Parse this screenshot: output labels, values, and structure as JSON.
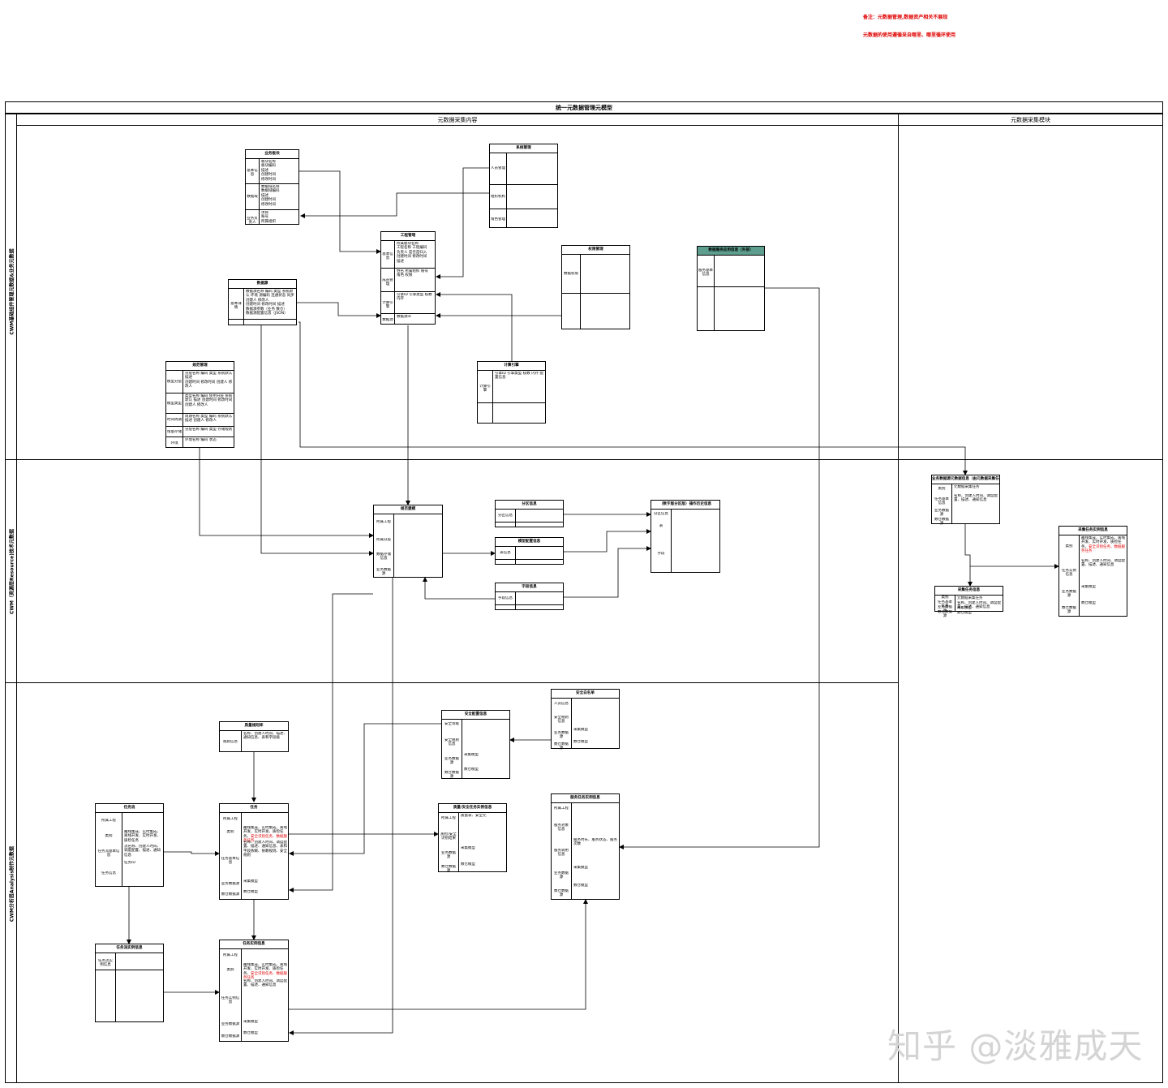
{
  "notes": [
    "备注：元数据管理,数据资产相关不展现",
    "元数据的使用遵循采自哪里、哪里循环使用"
  ],
  "main_title": "统一元数据管理元模型",
  "column_titles": {
    "content": "元数据采集内容",
    "module": "元数据采集模块"
  },
  "lanes": [
    "CWM基础组件管理元数据&业务元数据",
    "CWM（资源层Resource)技术元数据",
    "CWM分析层Analysis制作元数据"
  ],
  "watermark": "知乎 @淡雅成天",
  "entities": {
    "business_module": {
      "title": "业务板块",
      "rows": [
        {
          "k": "基本信息",
          "v": "板块名称\n板块编码\n描述\n创建时间\n修改时间"
        },
        {
          "k": "数据域",
          "v": "数据域名称\n数据域编码\n描述\n创建时间\n修改时间"
        },
        {
          "k": "业务负责人",
          "v": "项目\n账号\n所属组织"
        }
      ]
    },
    "system_mgmt": {
      "title": "系统管理",
      "rows": [
        {
          "k": "人员管理",
          "v": ""
        },
        {
          "k": "组织机构",
          "v": ""
        },
        {
          "k": "角色管理",
          "v": ""
        }
      ]
    },
    "project_mgmt": {
      "title": "工程管理",
      "rows": [
        {
          "k": "基本信息",
          "v": "所属板块名称\n工程名称 工程编码\n负责人 是否是归入\n创建时间 修改时间\n描述"
        },
        {
          "k": "成员管理",
          "v": "姓名 所属组织 账号\n角色 权限"
        },
        {
          "k": "计算引擎",
          "v": "引擎ID 引擎类型 核数\n内存"
        },
        {
          "k": "数据源",
          "v": "数据源id"
        }
      ]
    },
    "permission_mgmt": {
      "title": "权限管理",
      "rows": [
        {
          "k": "数据权限",
          "v": ""
        },
        {
          "k": "",
          "v": ""
        }
      ]
    },
    "data_service_ext": {
      "title": "数据服务应用信息（外部）",
      "rows": [
        {
          "k": "服务基本信息",
          "v": ""
        },
        {
          "k": "",
          "v": ""
        }
      ]
    },
    "data_source": {
      "title": "数据源",
      "rows": [
        {
          "k": "基本详情",
          "v": "数据源名称 编码 类型 系统默认 环境 源编码 连通状态 同步 创建人 修改人\n创建时间 修改时间 描述\n数据源参数（业务 数仓）\n数据源配置信息（JSON）"
        },
        {
          "k": "",
          "v": ""
        }
      ]
    },
    "compute_engine": {
      "title": "计算引擎",
      "rows": [
        {
          "k": "计算引擎",
          "v": "引擎ID 引擎类型 核数 内存 配置信息"
        },
        {
          "k": "",
          "v": ""
        }
      ]
    },
    "spec_mgmt": {
      "title": "规范管理",
      "rows": [
        {
          "k": "模型分层",
          "v": "分层名称 编码 类型 系统默认 描述\n创建时间 修改时间 创建人 修改人"
        },
        {
          "k": "模型类型",
          "v": "类型名称 编码 使用分层 系统默认 描述 创建时间 修改时间\n创建人 修改人"
        },
        {
          "k": "时间周期",
          "v": "周期名称 类型 编码 系统默认 描述 创建人 修改人"
        },
        {
          "k": "增量存储",
          "v": "分层名称 编码 类型 存储规则"
        },
        {
          "k": "环境",
          "v": "环境名称 编码 状态"
        }
      ]
    },
    "spec_model": {
      "title": "规范建模",
      "rows": [
        {
          "k": "所属工程",
          "v": ""
        },
        {
          "k": "所属分层",
          "v": ""
        },
        {
          "k": "数据存储信息",
          "v": ""
        },
        {
          "k": "业务数据源",
          "v": ""
        }
      ]
    },
    "partition_info": {
      "title": "分区信息",
      "rows": [
        {
          "k": "分区信息",
          "v": ""
        },
        {
          "k": "",
          "v": ""
        }
      ]
    },
    "model_config": {
      "title": "模型配置信息",
      "rows": [
        {
          "k": "表信息",
          "v": ""
        },
        {
          "k": "",
          "v": ""
        }
      ]
    },
    "field_info": {
      "title": "字段信息",
      "rows": [
        {
          "k": "字段信息",
          "v": ""
        },
        {
          "k": "",
          "v": ""
        }
      ]
    },
    "table_history": {
      "title": "（数字版分区版）操作历史信息",
      "rows": [
        {
          "k": "分区信息",
          "v": ""
        },
        {
          "k": "表",
          "v": ""
        },
        {
          "k": "字段",
          "v": ""
        }
      ]
    },
    "biz_collect": {
      "title": "业务数据源元数据信息（由元数据采集任务生成）",
      "rows": [
        {
          "k": "类别",
          "v": "元数据采集任务"
        },
        {
          "k": "任务基本信息",
          "v": "名称、创建人时间、调度配置、描述、通知信息"
        },
        {
          "k": "业务数据源",
          "v": ""
        },
        {
          "k": "数仓数据源",
          "v": ""
        }
      ]
    },
    "collect_task_inst": {
      "title": "采集任务实例信息",
      "rows": [
        {
          "k": "类别",
          "v": "離线集成、实时集成、离线开发、实时开发、质检任务、",
          "red": "安全识别任务、数据服务任务"
        },
        {
          "k": "任务实例信息",
          "v": "名称、创建人时间、调度配置、描述、通知信息"
        },
        {
          "k": "业务数据源",
          "v": "采集模型"
        },
        {
          "k": "数仓数据源",
          "v": "数仓模型"
        }
      ]
    },
    "collect_task": {
      "title": "采集任务信息",
      "rows": [
        {
          "k": "类别",
          "v": "元数据采集任务"
        },
        {
          "k": "任务基本信息",
          "v": "名称、创建人时间、调度配置、描述、通知信息"
        },
        {
          "k": "业务数据源",
          "v": "采集模型"
        },
        {
          "k": "数仓数据源",
          "v": "数仓模型"
        }
      ]
    },
    "security_whitelist": {
      "title": "安全白名单",
      "rows": [
        {
          "k": "人员信息",
          "v": ""
        },
        {
          "k": "安全规则信息",
          "v": ""
        },
        {
          "k": "业务数据源",
          "v": "采集模型"
        },
        {
          "k": "数仓数据源",
          "v": "数仓模型"
        }
      ]
    },
    "security_config": {
      "title": "安全配置信息",
      "rows": [
        {
          "k": "安全等级",
          "v": ""
        },
        {
          "k": "安全规则信息",
          "v": ""
        },
        {
          "k": "业务数据源",
          "v": "采集模型"
        },
        {
          "k": "数仓数据源",
          "v": "数仓模型"
        }
      ]
    },
    "rule_lib": {
      "title": "质量规则库",
      "rows": [
        {
          "k": "规则信息",
          "v": "名称、创建人时间、描述、通知信息、表和字段级"
        }
      ]
    },
    "task_flow": {
      "title": "任务流",
      "rows": [
        {
          "k": "所属工程",
          "v": ""
        },
        {
          "k": "类别",
          "v": "離线集成、实时集成、离线开发、实时开发、质检任务"
        },
        {
          "k": "任务流基本信息",
          "v": "流名称、创建人时间、调度配置、描述、通知信息"
        },
        {
          "k": "任务信息",
          "v": "任务ID"
        }
      ]
    },
    "task": {
      "title": "任务",
      "rows": [
        {
          "k": "所属工程",
          "v": ""
        },
        {
          "k": "类别",
          "v": "離线集成、实时集成、离线开发、实时开发、质检任务、",
          "red": "安全识别任务、数据服务任务"
        },
        {
          "k": "任务基本信息",
          "v": "名称、创建人时间、调度配置、描述、通知信息、表和字段依赖、依赖规则、安全规则"
        },
        {
          "k": "业务数据源",
          "v": "采集模型"
        },
        {
          "k": "数仓数据源",
          "v": "数仓模型"
        }
      ]
    },
    "quality_task_inst": {
      "title": "质量/安全任务实例信息",
      "rows": [
        {
          "k": "所属工程",
          "v": "质量表、安全元"
        },
        {
          "k": "质检/安全识别结果",
          "v": ""
        },
        {
          "k": "业务数据源",
          "v": "采集模型"
        },
        {
          "k": "数仓数据源",
          "v": "数仓模型"
        }
      ]
    },
    "service_task_inst": {
      "title": "服务任务实例信息",
      "rows": [
        {
          "k": "所属工程",
          "v": ""
        },
        {
          "k": "服务对象信息",
          "v": ""
        },
        {
          "k": "服务调用信息",
          "v": "服务时长、服务状态、服务次数"
        },
        {
          "k": "业务数据源",
          "v": "采集模型"
        },
        {
          "k": "数仓数据源",
          "v": "数仓模型"
        }
      ]
    },
    "task_flow_inst": {
      "title": "任务流实例信息",
      "rows": [
        {
          "k": "任务流实例信息",
          "v": ""
        },
        {
          "k": "",
          "v": ""
        }
      ]
    },
    "task_inst": {
      "title": "任务实例信息",
      "rows": [
        {
          "k": "所属工程",
          "v": ""
        },
        {
          "k": "类别",
          "v": "離线集成、实时集成、离线开发、实时开发、质检任务、",
          "red": "安全识别任务、数据服务任务"
        },
        {
          "k": "任务实例信息",
          "v": "名称、创建人时间、调度配置、描述、通知信息"
        },
        {
          "k": "业务数据源",
          "v": "采集模型"
        },
        {
          "k": "数仓数据源",
          "v": "数仓模型"
        }
      ]
    }
  }
}
